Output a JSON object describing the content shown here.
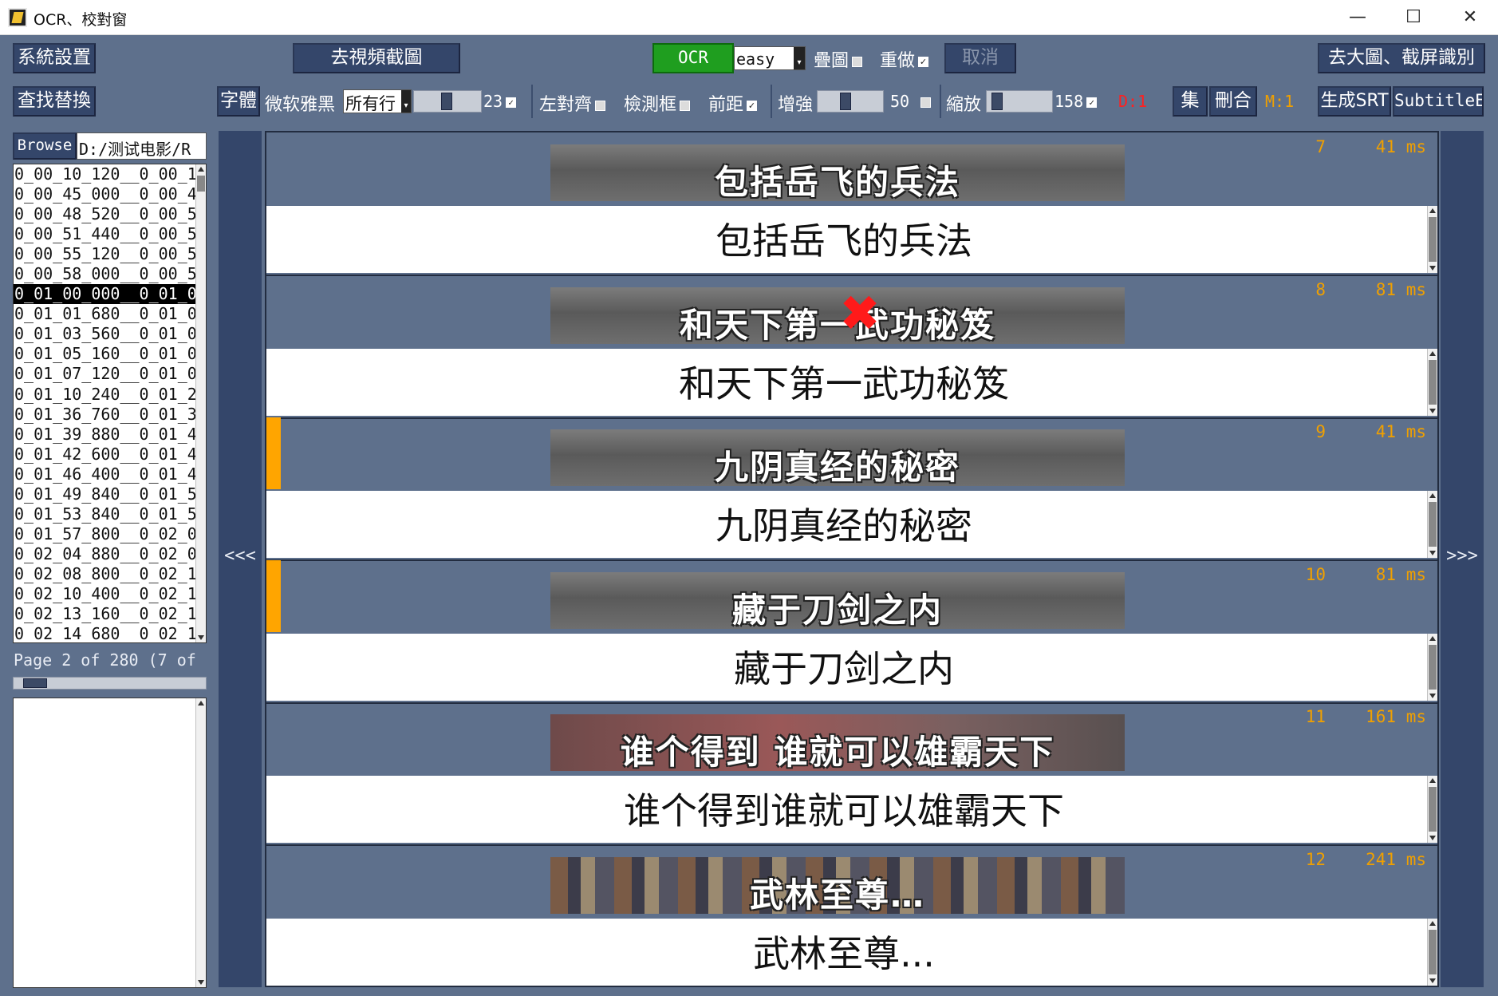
{
  "window": {
    "title": "OCR、校對窗",
    "minimize": "—",
    "maximize": "☐",
    "close": "✕"
  },
  "toolbar1": {
    "settings": "系統設置",
    "to_frame": "去視頻截圖",
    "ocr": "OCR",
    "engine": "easy",
    "overlay_label": "疊圖",
    "redo_label": "重做",
    "cancel": "取消",
    "to_big": "去大圖、截屏識別"
  },
  "toolbar2": {
    "find_replace": "查找替換",
    "font_btn": "字體",
    "font_name": "微软雅黑",
    "font_scope": "所有行",
    "font_size": "23",
    "left_align": "左對齊",
    "detect_box": "檢測框",
    "front_distance": "前距",
    "enhance": "增強",
    "enhance_value": "50",
    "zoom": "縮放",
    "zoom_value": "158",
    "d_indicator": "D:1",
    "collect": "集",
    "delete_merge": "刪合",
    "m_indicator": "M:1",
    "gen_srt": "生成SRT",
    "subtitle_edit": "SubtitleE"
  },
  "browser": {
    "browse_label": "Browse",
    "path": "D:/测试电影/R",
    "files": [
      "0_00_10_120__0_00_1",
      "0_00_45_000__0_00_4",
      "0_00_48_520__0_00_5",
      "0_00_51_440__0_00_5",
      "0_00_55_120__0_00_5",
      "0_00_58_000__0_00_5",
      "0_01_00_000__0_01_0",
      "0_01_01_680__0_01_0",
      "0_01_03_560__0_01_0",
      "0_01_05_160__0_01_0",
      "0_01_07_120__0_01_0",
      "0_01_10_240__0_01_2",
      "0_01_36_760__0_01_3",
      "0_01_39_880__0_01_4",
      "0_01_42_600__0_01_4",
      "0_01_46_400__0_01_4",
      "0_01_49_840__0_01_5",
      "0_01_53_840__0_01_5",
      "0_01_57_800__0_02_0",
      "0_02_04_880__0_02_0",
      "0_02_08_800__0_02_1",
      "0_02_10_400__0_02_1",
      "0_02_13_160__0_02_1",
      "0_02_14_680__0_02_1"
    ],
    "selected_index": 6,
    "page_info": "Page 2 of 280 (7 of",
    "page_progress": 0.12
  },
  "nav": {
    "prev": "<<<",
    "next": ">>>"
  },
  "cards": [
    {
      "image_text": "包括岳飞的兵法",
      "answer": "包括岳飞的兵法",
      "index": "7",
      "ms": "41 ms",
      "marked": false,
      "error": false,
      "style": "gray"
    },
    {
      "image_text": "和天下第一武功秘笈",
      "answer": "和天下第一武功秘笈",
      "index": "8",
      "ms": "81 ms",
      "marked": false,
      "error": true,
      "style": "gray"
    },
    {
      "image_text": "九阴真经的秘密",
      "answer": "九阴真经的秘密",
      "index": "9",
      "ms": "41 ms",
      "marked": true,
      "error": false,
      "style": "gray"
    },
    {
      "image_text": "藏于刀剑之内",
      "answer": "藏于刀剑之内",
      "index": "10",
      "ms": "81 ms",
      "marked": true,
      "error": false,
      "style": "gray"
    },
    {
      "image_text": "谁个得到  谁就可以雄霸天下",
      "answer": "谁个得到谁就可以雄霸天下",
      "index": "11",
      "ms": "161 ms",
      "marked": false,
      "error": false,
      "style": "red"
    },
    {
      "image_text": "武林至尊…",
      "answer": "武林至尊...",
      "index": "12",
      "ms": "241 ms",
      "marked": false,
      "error": false,
      "style": "crowd"
    }
  ],
  "colors": {
    "background": "#5e708c",
    "button": "#34466a",
    "ocr_green": "#1f9e1f",
    "accent_orange": "#f0a000",
    "marker": "#ffa500",
    "d_red": "#ff2020"
  }
}
